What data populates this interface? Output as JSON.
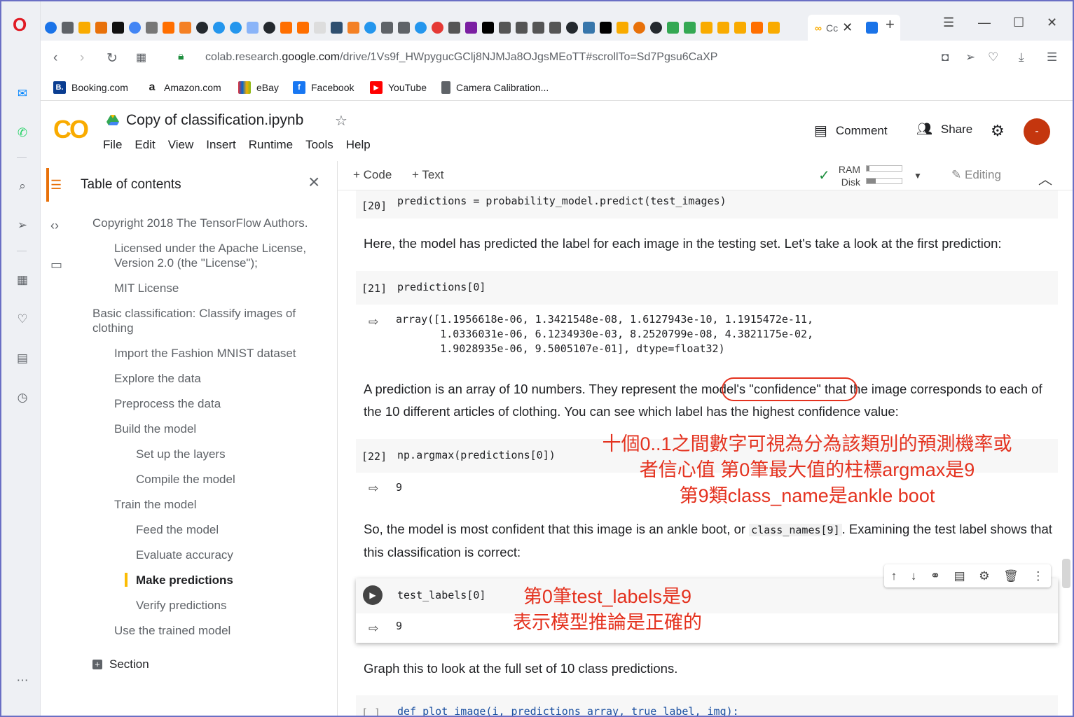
{
  "browser": {
    "logo": "O",
    "active_tab_title": "Cc",
    "url_prefix": "colab.research.",
    "url_domain": "google.com",
    "url_path": "/drive/1Vs9f_HWpygucGClj8NJMJa8OJgsMEoTT#scrollTo=Sd7Pgsu6CaXP",
    "bookmarks": [
      {
        "label": "Booking.com",
        "icon": "B.",
        "color": "#0a3d91"
      },
      {
        "label": "Amazon.com",
        "icon": "a",
        "color": "#222222"
      },
      {
        "label": "eBay",
        "icon": "bag-icon",
        "color": "#e53238"
      },
      {
        "label": "Facebook",
        "icon": "f",
        "color": "#1877f2"
      },
      {
        "label": "YouTube",
        "icon": "▶",
        "color": "#ff0000"
      },
      {
        "label": "Camera Calibration...",
        "icon": "doc-icon",
        "color": "#5f6368"
      }
    ]
  },
  "colab": {
    "logo": "CO",
    "title": "Copy of classification.ipynb",
    "menus": [
      "File",
      "Edit",
      "View",
      "Insert",
      "Runtime",
      "Tools",
      "Help"
    ],
    "comment_label": "Comment",
    "share_label": "Share",
    "avatar": "-",
    "accent": "#f9ab00"
  },
  "toc": {
    "title": "Table of contents",
    "items": [
      {
        "label": "Copyright 2018 The TensorFlow Authors."
      },
      {
        "label": "Licensed under the Apache License, Version 2.0 (the \"License\");"
      },
      {
        "label": "MIT License"
      },
      {
        "label": "Basic classification: Classify images of clothing"
      },
      {
        "label": "Import the Fashion MNIST dataset"
      },
      {
        "label": "Explore the data"
      },
      {
        "label": "Preprocess the data"
      },
      {
        "label": "Build the model"
      },
      {
        "label": "Set up the layers"
      },
      {
        "label": "Compile the model"
      },
      {
        "label": "Train the model"
      },
      {
        "label": "Feed the model"
      },
      {
        "label": "Evaluate accuracy"
      },
      {
        "label": "Make predictions"
      },
      {
        "label": "Verify predictions"
      },
      {
        "label": "Use the trained model"
      }
    ],
    "section_label": "Section"
  },
  "toolbar": {
    "add_code": "+ Code",
    "add_text": "+ Text",
    "ram_label": "RAM",
    "disk_label": "Disk",
    "editing_label": "Editing"
  },
  "cells": {
    "c20_prompt": "[20]",
    "c20_code": "predictions = probability_model.predict(test_images)",
    "md1": "Here, the model has predicted the label for each image in the testing set. Let's take a look at the first prediction:",
    "c21_prompt": "[21]",
    "c21_code": "predictions[0]",
    "c21_out": "array([1.1956618e-06, 1.3421548e-08, 1.6127943e-10, 1.1915472e-11,\n       1.0336031e-06, 6.1234930e-03, 8.2520799e-08, 4.3821175e-02,\n       1.9028935e-06, 9.5005107e-01], dtype=float32)",
    "md2_a": "A prediction is an array of 10 numbers. They represent the ",
    "md2_b": "model's \"confidence\"",
    "md2_c": " that the image corresponds to each of the 10 different articles of clothing. You can see which label has the highest confidence value:",
    "c22_prompt": "[22]",
    "c22_code": "np.argmax(predictions[0])",
    "c22_out": "9",
    "md3_a": "So, the model is most confident that this image is an ankle boot, or ",
    "md3_code": "class_names[9]",
    "md3_b": ". Examining the test label shows that this classification is correct:",
    "c23_code": "test_labels[0]",
    "c23_out": "9",
    "md4": "Graph this to look at the full set of 10 class predictions.",
    "c24_prompt": "[ ]",
    "c24_code": "def plot_image(i, predictions_array, true_label, img):"
  },
  "annotations": {
    "note1_line1": "十個0..1之間數字可視為分為該類別的預測機率或",
    "note1_line2": "者信心值 第0筆最大值的柱標argmax是9",
    "note1_line3": "第9類class_name是ankle boot",
    "note2_line1": "第0筆test_labels是9",
    "note2_line2": "表示模型推論是正確的",
    "color": "#e4321f"
  }
}
